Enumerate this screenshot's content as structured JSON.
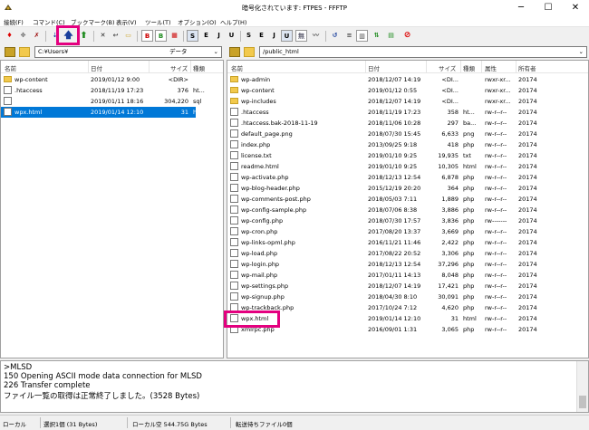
{
  "window": {
    "title": "暗号化されています: FTPES - FFFTP",
    "minimize": "─",
    "maximize": "☐",
    "close": "✕"
  },
  "menu": [
    "接続(F)",
    "コマンド(C)",
    "ブックマーク(B)",
    "表示(V)",
    "ツール(T)",
    "オプション(O)",
    "ヘルプ(H)"
  ],
  "toolbar": {
    "items": [
      "S",
      "E",
      "J",
      "U",
      "S",
      "E",
      "J",
      "U",
      "無"
    ]
  },
  "colors": {
    "highlight": "#e4007f",
    "selection": "#0078d7",
    "upload": "#1a3f9c"
  },
  "left_pane": {
    "path": "C:¥Users¥",
    "path_dropdown": "データ",
    "headers": {
      "name": "名前",
      "date": "日付",
      "size": "サイズ",
      "type": "種類"
    },
    "rows": [
      {
        "name": "wp-content",
        "date": "2019/01/12  9:00",
        "size": "<DIR>",
        "type": "",
        "icon": "folder",
        "selected": false
      },
      {
        "name": ".htaccess",
        "date": "2018/11/19 17:23",
        "size": "376",
        "type": "ht...",
        "icon": "file",
        "selected": false
      },
      {
        "name": "",
        "date": "2019/01/11 18:16",
        "size": "304,220",
        "type": "sql",
        "icon": "file",
        "selected": false
      },
      {
        "name": "wpx.html",
        "date": "2019/01/14 12:10",
        "size": "31",
        "type": "html",
        "icon": "file",
        "selected": true
      }
    ]
  },
  "right_pane": {
    "path": "/public_html",
    "headers": {
      "name": "名前",
      "date": "日付",
      "size": "サイズ",
      "type": "種類",
      "attr": "属性",
      "owner": "所有者"
    },
    "rows": [
      {
        "name": "wp-admin",
        "date": "2018/12/07 14:19",
        "size": "<DI...",
        "type": "",
        "attr": "rwxr-xr...",
        "owner": "20174",
        "icon": "folder"
      },
      {
        "name": "wp-content",
        "date": "2019/01/12  0:55",
        "size": "<DI...",
        "type": "",
        "attr": "rwxr-xr...",
        "owner": "20174",
        "icon": "folder"
      },
      {
        "name": "wp-includes",
        "date": "2018/12/07 14:19",
        "size": "<DI...",
        "type": "",
        "attr": "rwxr-xr...",
        "owner": "20174",
        "icon": "folder"
      },
      {
        "name": ".htaccess",
        "date": "2018/11/19 17:23",
        "size": "358",
        "type": "ht...",
        "attr": "rw-r--r--",
        "owner": "20174",
        "icon": "file"
      },
      {
        "name": ".htaccess.bak-2018-11-19",
        "date": "2018/11/06 10:28",
        "size": "297",
        "type": "ba...",
        "attr": "rw-r--r--",
        "owner": "20174",
        "icon": "file"
      },
      {
        "name": "default_page.png",
        "date": "2018/07/30 15:45",
        "size": "6,633",
        "type": "png",
        "attr": "rw-r--r--",
        "owner": "20174",
        "icon": "file"
      },
      {
        "name": "index.php",
        "date": "2013/09/25  9:18",
        "size": "418",
        "type": "php",
        "attr": "rw-r--r--",
        "owner": "20174",
        "icon": "file"
      },
      {
        "name": "license.txt",
        "date": "2019/01/10  9:25",
        "size": "19,935",
        "type": "txt",
        "attr": "rw-r--r--",
        "owner": "20174",
        "icon": "file"
      },
      {
        "name": "readme.html",
        "date": "2019/01/10  9:25",
        "size": "10,305",
        "type": "html",
        "attr": "rw-r--r--",
        "owner": "20174",
        "icon": "file"
      },
      {
        "name": "wp-activate.php",
        "date": "2018/12/13 12:54",
        "size": "6,878",
        "type": "php",
        "attr": "rw-r--r--",
        "owner": "20174",
        "icon": "file"
      },
      {
        "name": "wp-blog-header.php",
        "date": "2015/12/19 20:20",
        "size": "364",
        "type": "php",
        "attr": "rw-r--r--",
        "owner": "20174",
        "icon": "file"
      },
      {
        "name": "wp-comments-post.php",
        "date": "2018/05/03  7:11",
        "size": "1,889",
        "type": "php",
        "attr": "rw-r--r--",
        "owner": "20174",
        "icon": "file"
      },
      {
        "name": "wp-config-sample.php",
        "date": "2018/07/06  8:38",
        "size": "3,886",
        "type": "php",
        "attr": "rw-r--r--",
        "owner": "20174",
        "icon": "file"
      },
      {
        "name": "wp-config.php",
        "date": "2018/07/30 17:57",
        "size": "3,836",
        "type": "php",
        "attr": "rw-------",
        "owner": "20174",
        "icon": "file"
      },
      {
        "name": "wp-cron.php",
        "date": "2017/08/20 13:37",
        "size": "3,669",
        "type": "php",
        "attr": "rw-r--r--",
        "owner": "20174",
        "icon": "file"
      },
      {
        "name": "wp-links-opml.php",
        "date": "2016/11/21 11:46",
        "size": "2,422",
        "type": "php",
        "attr": "rw-r--r--",
        "owner": "20174",
        "icon": "file"
      },
      {
        "name": "wp-load.php",
        "date": "2017/08/22 20:52",
        "size": "3,306",
        "type": "php",
        "attr": "rw-r--r--",
        "owner": "20174",
        "icon": "file"
      },
      {
        "name": "wp-login.php",
        "date": "2018/12/13 12:54",
        "size": "37,296",
        "type": "php",
        "attr": "rw-r--r--",
        "owner": "20174",
        "icon": "file"
      },
      {
        "name": "wp-mail.php",
        "date": "2017/01/11 14:13",
        "size": "8,048",
        "type": "php",
        "attr": "rw-r--r--",
        "owner": "20174",
        "icon": "file"
      },
      {
        "name": "wp-settings.php",
        "date": "2018/12/07 14:19",
        "size": "17,421",
        "type": "php",
        "attr": "rw-r--r--",
        "owner": "20174",
        "icon": "file"
      },
      {
        "name": "wp-signup.php",
        "date": "2018/04/30  8:10",
        "size": "30,091",
        "type": "php",
        "attr": "rw-r--r--",
        "owner": "20174",
        "icon": "file"
      },
      {
        "name": "wp-trackback.php",
        "date": "2017/10/24  7:12",
        "size": "4,620",
        "type": "php",
        "attr": "rw-r--r--",
        "owner": "20174",
        "icon": "file"
      },
      {
        "name": "wpx.html",
        "date": "2019/01/14 12:10",
        "size": "31",
        "type": "html",
        "attr": "rw-r--r--",
        "owner": "20174",
        "icon": "file"
      },
      {
        "name": "xmlrpc.php",
        "date": "2016/09/01  1:31",
        "size": "3,065",
        "type": "php",
        "attr": "rw-r--r--",
        "owner": "20174",
        "icon": "file"
      }
    ]
  },
  "log": [
    ">MLSD",
    "150 Opening ASCII mode data connection for MLSD",
    "226 Transfer complete",
    "ファイル一覧の取得は正常終了しました。(3528 Bytes)"
  ],
  "status": {
    "local": "ローカル",
    "selected": "選択1個 (31 Bytes)",
    "free": "ローカル空 544.75G Bytes",
    "queue": "転送待ちファイル0個"
  }
}
